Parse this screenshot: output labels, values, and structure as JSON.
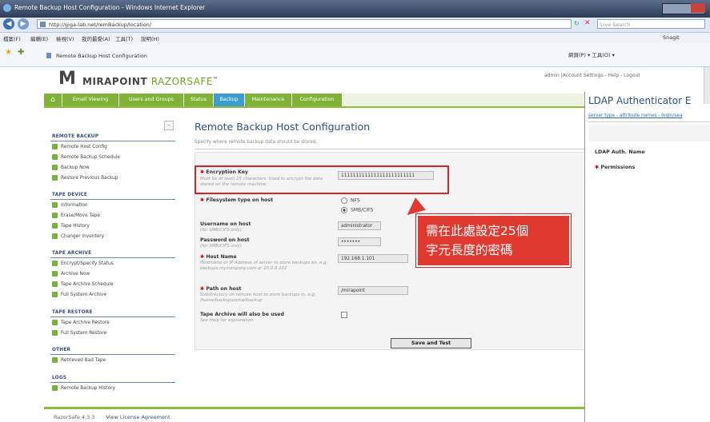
{
  "browser": {
    "window_title": "Remote Backup Host Configuration - Windows Internet Explorer",
    "address": "http://giga-lab.net/remBackup/location/",
    "search_placeholder": "Live Search",
    "menu": [
      "檔案(F)",
      "編輯(E)",
      "檢視(V)",
      "我的最愛(A)",
      "工具(T)",
      "說明(H)"
    ],
    "menu_right": "Snagit",
    "tab_title": "Remote Backup Host Configuration",
    "tools": "網頁(P) ▾  工具(O) ▾"
  },
  "app": {
    "logo_plain": "MIRAPOINT ",
    "logo_accent": "RAZORSAFE",
    "logo_tm": "™",
    "top_links": "admin  |Account Settings - Help - Logout",
    "tabs": [
      "Email Viewing",
      "Users and Groups",
      "Status",
      "Backup",
      "Maintenance",
      "Configuration"
    ],
    "active_tab": "Backup"
  },
  "sidebar": {
    "sections": [
      {
        "title": "REMOTE BACKUP",
        "items": [
          "Remote Host Config",
          "Remote Backup Schedule",
          "Backup Now",
          "Restore Previous Backup"
        ]
      },
      {
        "title": "TAPE DEVICE",
        "items": [
          "Information",
          "Erase/Move Tape",
          "Tape History",
          "Changer Inventory"
        ]
      },
      {
        "title": "TAPE ARCHIVE",
        "items": [
          "Encrypt/Specify Status",
          "Archive Now",
          "Tape Archive Schedule",
          "Full System Archive"
        ]
      },
      {
        "title": "TAPE RESTORE",
        "items": [
          "Tape Archive Restore",
          "Full System Restore"
        ]
      },
      {
        "title": "OTHER",
        "items": [
          "Retrieved Bad Tape"
        ]
      },
      {
        "title": "LOGS",
        "items": [
          "Remote Backup History"
        ]
      }
    ]
  },
  "main": {
    "title": "Remote Backup Host Configuration",
    "subtitle": "Specify where remote backup data should be stored.",
    "encryption_label": "Encryption Key",
    "encryption_hint": "Must be at least 25 characters. Used to encrypt the data stored on the remote machine.",
    "encryption_value": "1111111111111111111111111",
    "fstype_label": "Filesystem type on host",
    "fstype_options": [
      "NFS",
      "SMB/CIFS"
    ],
    "fstype_selected": "SMB/CIFS",
    "username_label": "Username on host",
    "username_hint": "(for SMB/CIFS only)",
    "username_value": "administrator",
    "password_label": "Password on host",
    "password_hint": "(for SMB/CIFS only)",
    "password_value": "•••••••",
    "hostname_label": "Host Name",
    "hostname_hint": "Hostname or IP Address of server to store backups on, e.g. backups.mycompany.com or 10.0.0.222",
    "hostname_value": "192.168.1.101",
    "path_label": "Path on host",
    "path_hint": "Subdirectory on remote host to store backups in, e.g. /home/backups/emailbackup",
    "path_value": "/mirapoint",
    "tape_label": "Tape Archive will also be used",
    "tape_hint": "See Help for explanation",
    "save_button": "Save and Test"
  },
  "callout": {
    "line1": "需在此處設定25個",
    "line2": "字元長度的密碼"
  },
  "footer": {
    "version": "RazorSafe 4.3.3",
    "license_link": "View License Agreement"
  },
  "ldap": {
    "title": "LDAP Authenticator E",
    "links": "server type - attribute names - login/sea",
    "auth_name_label": "LDAP Auth. Name",
    "permissions_label": "Permissions"
  }
}
